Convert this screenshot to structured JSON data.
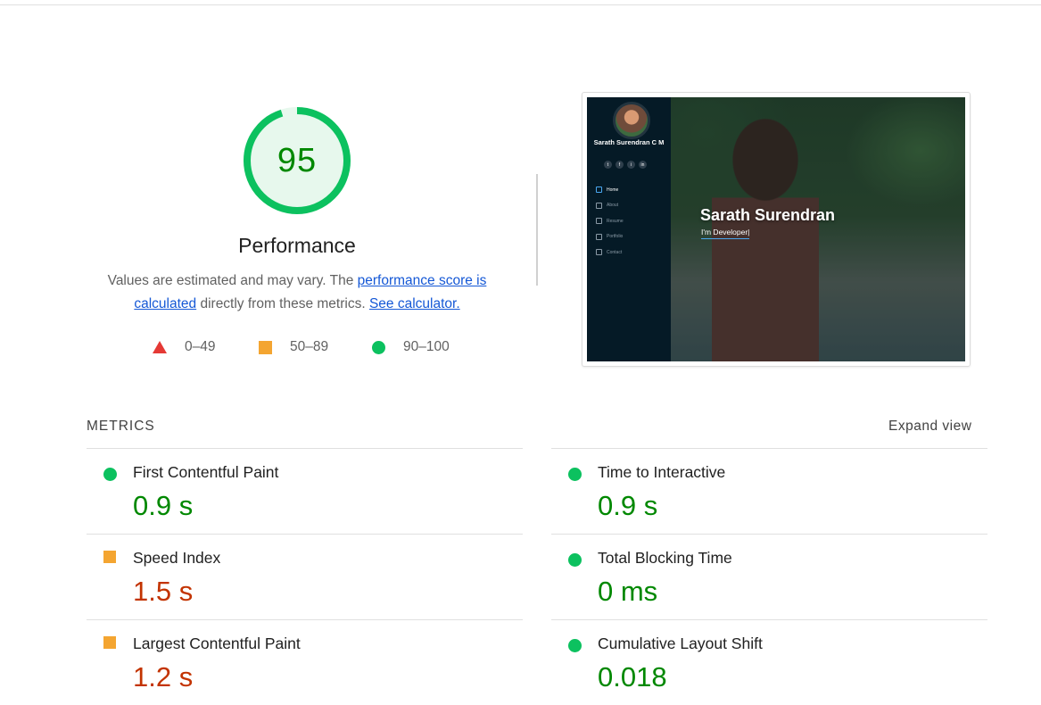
{
  "performance": {
    "score": "95",
    "score_fraction": 0.95,
    "title": "Performance",
    "desc_prefix": "Values are estimated and may vary. The ",
    "desc_link_1": "performance score is calculated",
    "desc_middle": " directly from these metrics. ",
    "desc_link_2": "See calculator.",
    "legend": [
      {
        "range": "0–49",
        "shape": "triangle",
        "color": "#e53935"
      },
      {
        "range": "50–89",
        "shape": "square",
        "color": "#f4a531"
      },
      {
        "range": "90–100",
        "shape": "circle",
        "color": "#0cc15f"
      }
    ],
    "gauge_color": "#0cc15f",
    "gauge_fill": "#e7f8ed",
    "score_color": "#008800"
  },
  "screenshot": {
    "side_name": "Sarath Surendran C M",
    "socials": [
      "t",
      "f",
      "i",
      "in"
    ],
    "nav": [
      "Home",
      "About",
      "Resume",
      "Portfolio",
      "Contact"
    ],
    "hero_name": "Sarath Surendran",
    "hero_role": "I'm Developer|"
  },
  "metrics": {
    "header": "METRICS",
    "expand_label": "Expand view",
    "left": [
      {
        "title": "First Contentful Paint",
        "value": "0.9 s",
        "rating": "pass"
      },
      {
        "title": "Speed Index",
        "value": "1.5 s",
        "rating": "average"
      },
      {
        "title": "Largest Contentful Paint",
        "value": "1.2 s",
        "rating": "average"
      }
    ],
    "right": [
      {
        "title": "Time to Interactive",
        "value": "0.9 s",
        "rating": "pass"
      },
      {
        "title": "Total Blocking Time",
        "value": "0 ms",
        "rating": "pass"
      },
      {
        "title": "Cumulative Layout Shift",
        "value": "0.018",
        "rating": "pass"
      }
    ]
  }
}
